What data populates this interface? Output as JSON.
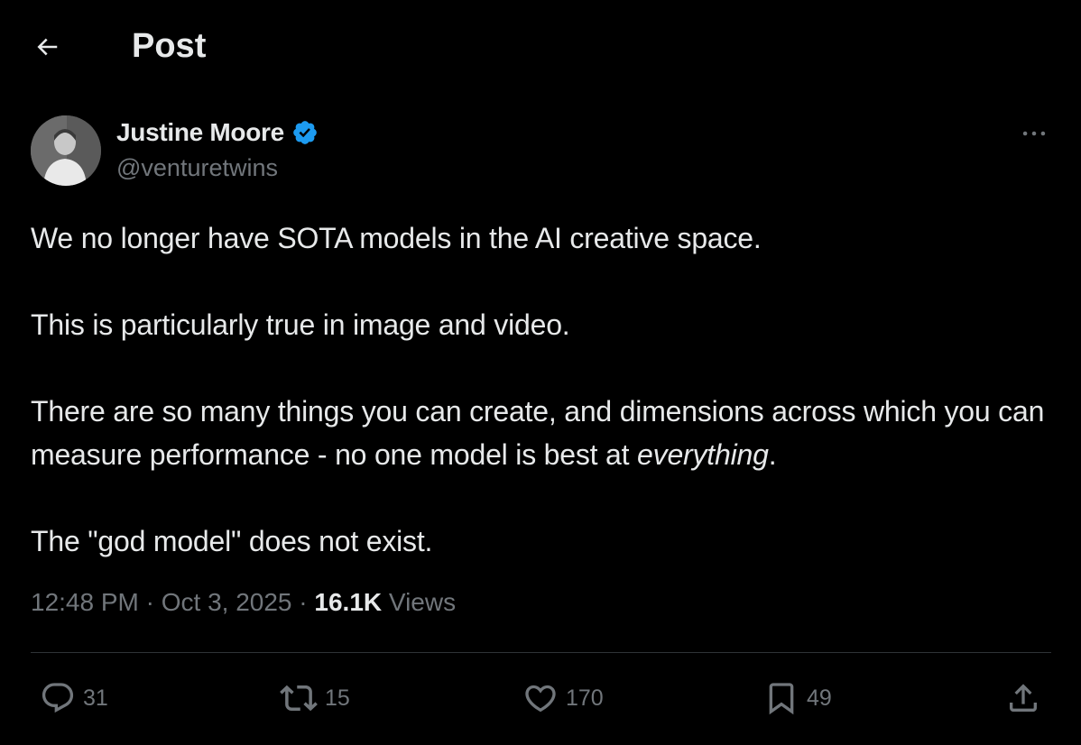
{
  "header": {
    "title": "Post",
    "back_icon": "arrow-left-icon"
  },
  "author": {
    "name": "Justine Moore",
    "handle": "@venturetwins",
    "verified": true,
    "verified_color": "#1d9bf0"
  },
  "post": {
    "paragraphs": [
      "We no longer have SOTA models in the AI creative space.",
      "This is particularly true in image and video.",
      "There are so many things you can create, and dimensions across which you can measure performance - no one model is best at ",
      "The \"god model\" does not exist."
    ],
    "emphasis": "everything",
    "emphasis_suffix": "."
  },
  "meta": {
    "time": "12:48 PM",
    "separator": "·",
    "date": "Oct 3, 2025",
    "views_count": "16.1K",
    "views_label": "Views"
  },
  "actions": {
    "replies": "31",
    "reposts": "15",
    "likes": "170",
    "bookmarks": "49"
  },
  "colors": {
    "background": "#000000",
    "text_primary": "#e7e9ea",
    "text_secondary": "#71767b",
    "divider": "#2f3336",
    "accent": "#1d9bf0"
  }
}
